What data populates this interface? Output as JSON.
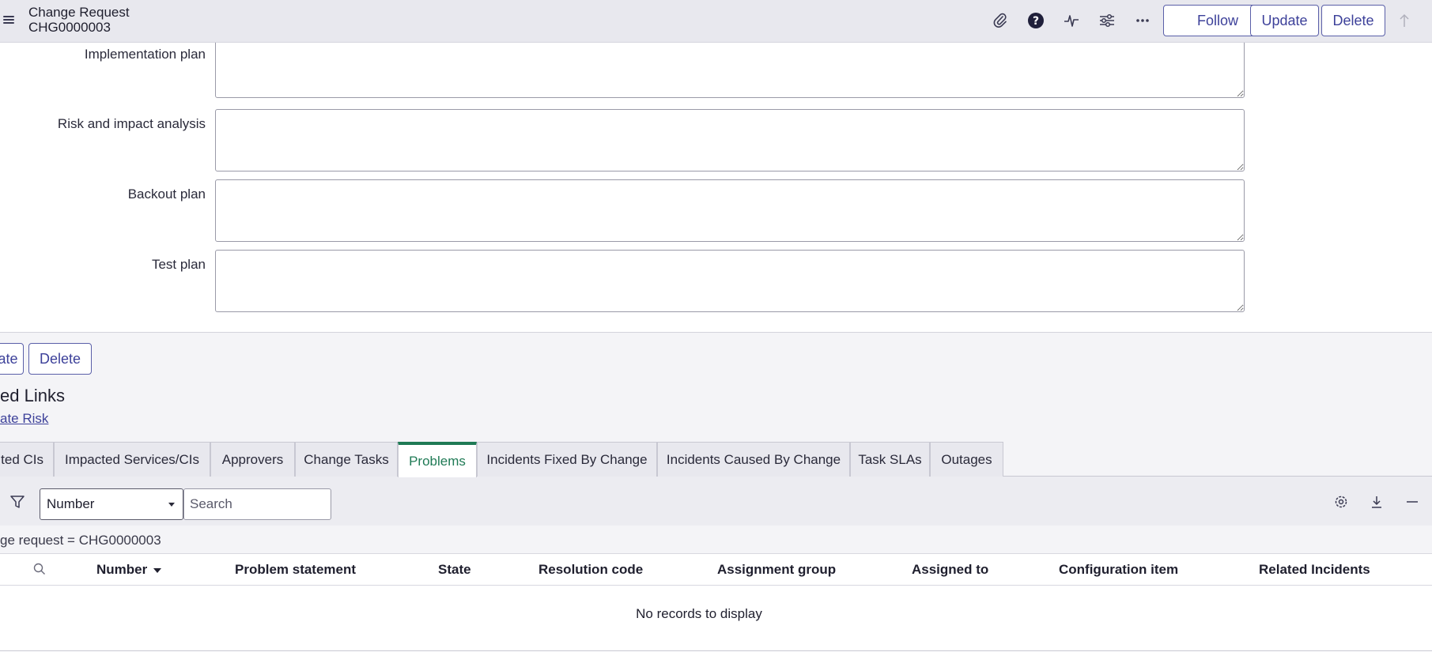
{
  "header": {
    "record_type": "Change Request",
    "record_number": "CHG0000003",
    "follow_label": "Follow",
    "update_label": "Update",
    "delete_label": "Delete"
  },
  "form": {
    "fields": [
      {
        "label": "Implementation plan",
        "value": ""
      },
      {
        "label": "Risk and impact analysis",
        "value": ""
      },
      {
        "label": "Backout plan",
        "value": ""
      },
      {
        "label": "Test plan",
        "value": ""
      }
    ]
  },
  "lower_actions": {
    "update_label_partial": "ate",
    "delete_label": "Delete"
  },
  "related_links": {
    "title_partial": "ed Links",
    "link_partial": "ate Risk"
  },
  "tabs": [
    {
      "label": "ted CIs",
      "active": false
    },
    {
      "label": "Impacted Services/CIs",
      "active": false
    },
    {
      "label": "Approvers",
      "active": false
    },
    {
      "label": "Change Tasks",
      "active": false
    },
    {
      "label": "Problems",
      "active": true
    },
    {
      "label": "Incidents Fixed By Change",
      "active": false
    },
    {
      "label": "Incidents Caused By Change",
      "active": false
    },
    {
      "label": "Task SLAs",
      "active": false
    },
    {
      "label": "Outages",
      "active": false
    }
  ],
  "list_toolbar": {
    "search_field": "Number",
    "search_placeholder": "Search"
  },
  "breadcrumb": "ge request = CHG0000003",
  "table": {
    "columns": [
      "Number",
      "Problem statement",
      "State",
      "Resolution code",
      "Assignment group",
      "Assigned to",
      "Configuration item",
      "Related Incidents"
    ],
    "sorted_column": "Number",
    "sort_direction": "descending",
    "empty_message": "No records to display"
  },
  "colors": {
    "accent": "#3d419a",
    "active_tab": "#1f7a55",
    "header_bg": "#e8e8ee"
  }
}
